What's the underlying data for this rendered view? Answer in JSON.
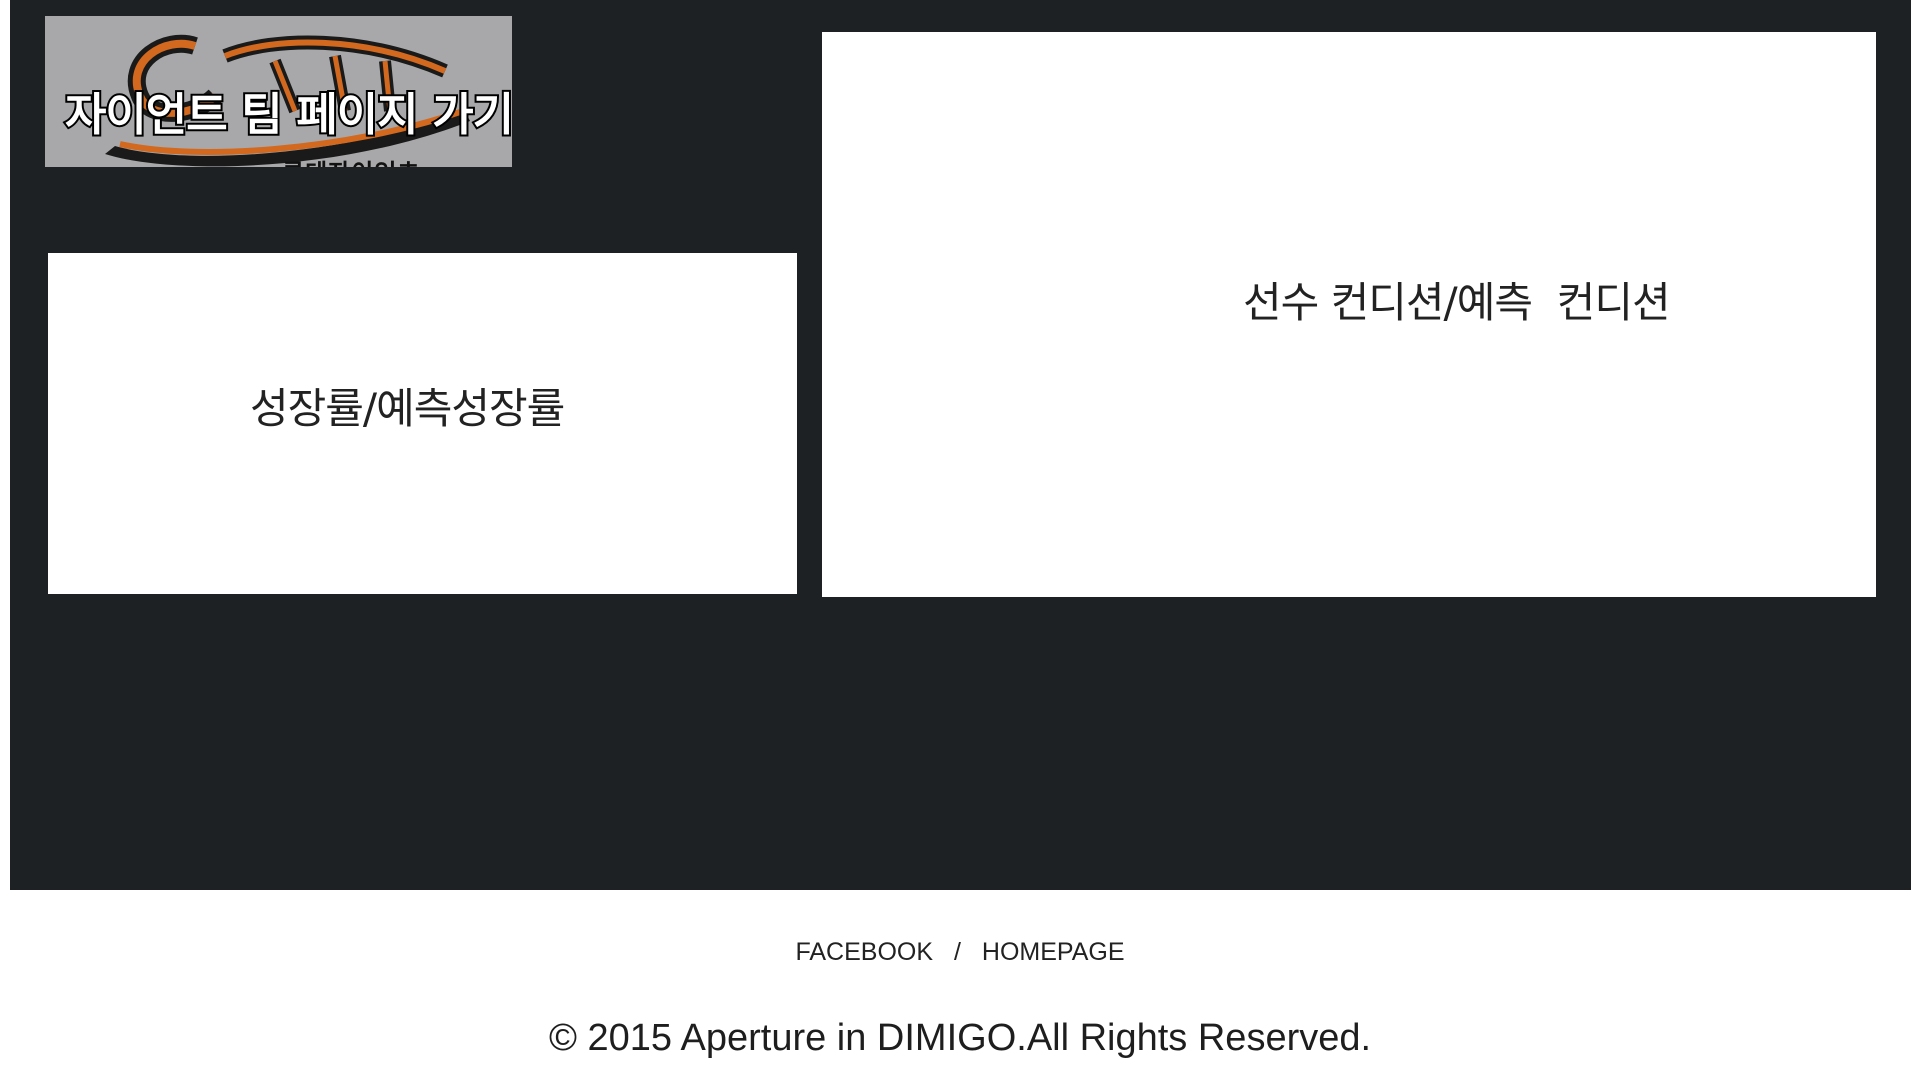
{
  "logo_banner": {
    "title": "자이언트 팀 페이지 가기",
    "subtitle": "롯데자이언츠",
    "emblem_script": "Giants",
    "emblem_icon": "giants-script-logo-icon",
    "background_color": "#a8a8aa",
    "emblem_color": "#d2691e"
  },
  "panels": {
    "growth": {
      "label": "성장률/예측성장률"
    },
    "condition": {
      "label": "선수 컨디션/예측  컨디션"
    }
  },
  "footer": {
    "links": [
      {
        "label": "FACEBOOK"
      },
      {
        "label": "HOMEPAGE"
      }
    ],
    "separator": "/",
    "copyright": "© 2015 Aperture in DIMIGO.All Rights Reserved."
  },
  "colors": {
    "dark_background": "#1e2124",
    "panel_background": "#ffffff",
    "page_background": "#ffffff"
  }
}
